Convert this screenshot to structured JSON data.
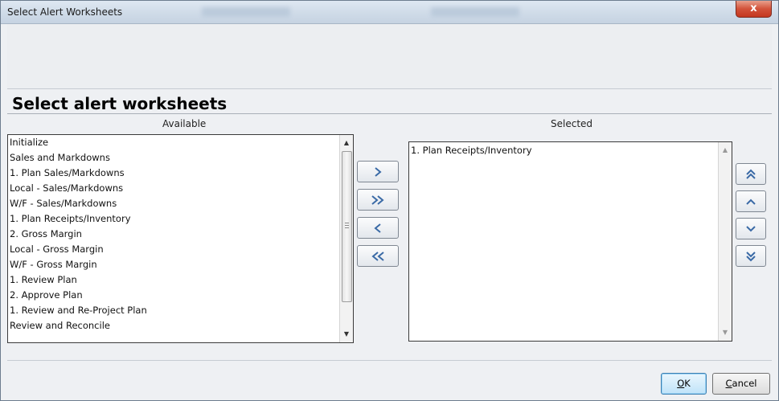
{
  "window": {
    "title": "Select Alert Worksheets",
    "close_label": "x"
  },
  "heading": "Select alert worksheets",
  "available": {
    "label": "Available",
    "items": [
      "Initialize",
      "Sales and Markdowns",
      "1. Plan Sales/Markdowns",
      "Local - Sales/Markdowns",
      "W/F - Sales/Markdowns",
      "1. Plan Receipts/Inventory",
      "2. Gross Margin",
      "Local - Gross Margin",
      "W/F - Gross Margin",
      "1. Review Plan",
      "2. Approve Plan",
      "1. Review and Re-Project Plan",
      "Review and Reconcile"
    ]
  },
  "selected": {
    "label": "Selected",
    "items": [
      "1. Plan Receipts/Inventory"
    ]
  },
  "move_buttons": {
    "add": "move-right",
    "add_all": "move-all-right",
    "remove": "move-left",
    "remove_all": "move-all-left"
  },
  "order_buttons": {
    "top": "move-to-top",
    "up": "move-up",
    "down": "move-down",
    "bottom": "move-to-bottom"
  },
  "buttons": {
    "ok_mnemonic": "O",
    "ok_rest": "K",
    "cancel_mnemonic": "C",
    "cancel_rest": "ancel"
  },
  "colors": {
    "icon": "#3a6aa6",
    "close": "#c4371f"
  }
}
